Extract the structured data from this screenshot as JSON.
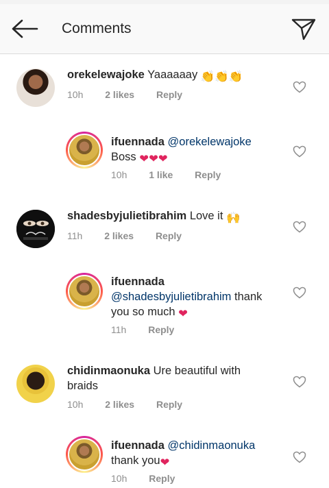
{
  "header": {
    "title": "Comments"
  },
  "comments": [
    {
      "username": "orekelewajoke",
      "text": "Yaaaaaay",
      "emoji": "👏👏👏",
      "time": "10h",
      "likes": "2 likes",
      "reply": "Reply"
    },
    {
      "username": "ifuennada",
      "mention": "@orekelewajoke",
      "text": "Boss",
      "emoji": "❤❤❤",
      "time": "10h",
      "likes": "1 like",
      "reply": "Reply"
    },
    {
      "username": "shadesbyjulietibrahim",
      "text": "Love it",
      "emoji": "🙌",
      "time": "11h",
      "likes": "2 likes",
      "reply": "Reply"
    },
    {
      "username": "ifuennada",
      "mention": "@shadesbyjulietibrahim",
      "text": "thank you so much",
      "emoji": "❤",
      "time": "11h",
      "likes": "",
      "reply": "Reply"
    },
    {
      "username": "chidinmaonuka",
      "text": "Ure beautiful with braids",
      "time": "10h",
      "likes": "2 likes",
      "reply": "Reply"
    },
    {
      "username": "ifuennada",
      "mention": "@chidinmaonuka",
      "text": "thank you",
      "emoji": "❤",
      "time": "10h",
      "likes": "",
      "reply": "Reply"
    }
  ],
  "colors": {
    "heart": "#e0245e",
    "mention": "#003569",
    "meta": "#8e8e8e"
  }
}
